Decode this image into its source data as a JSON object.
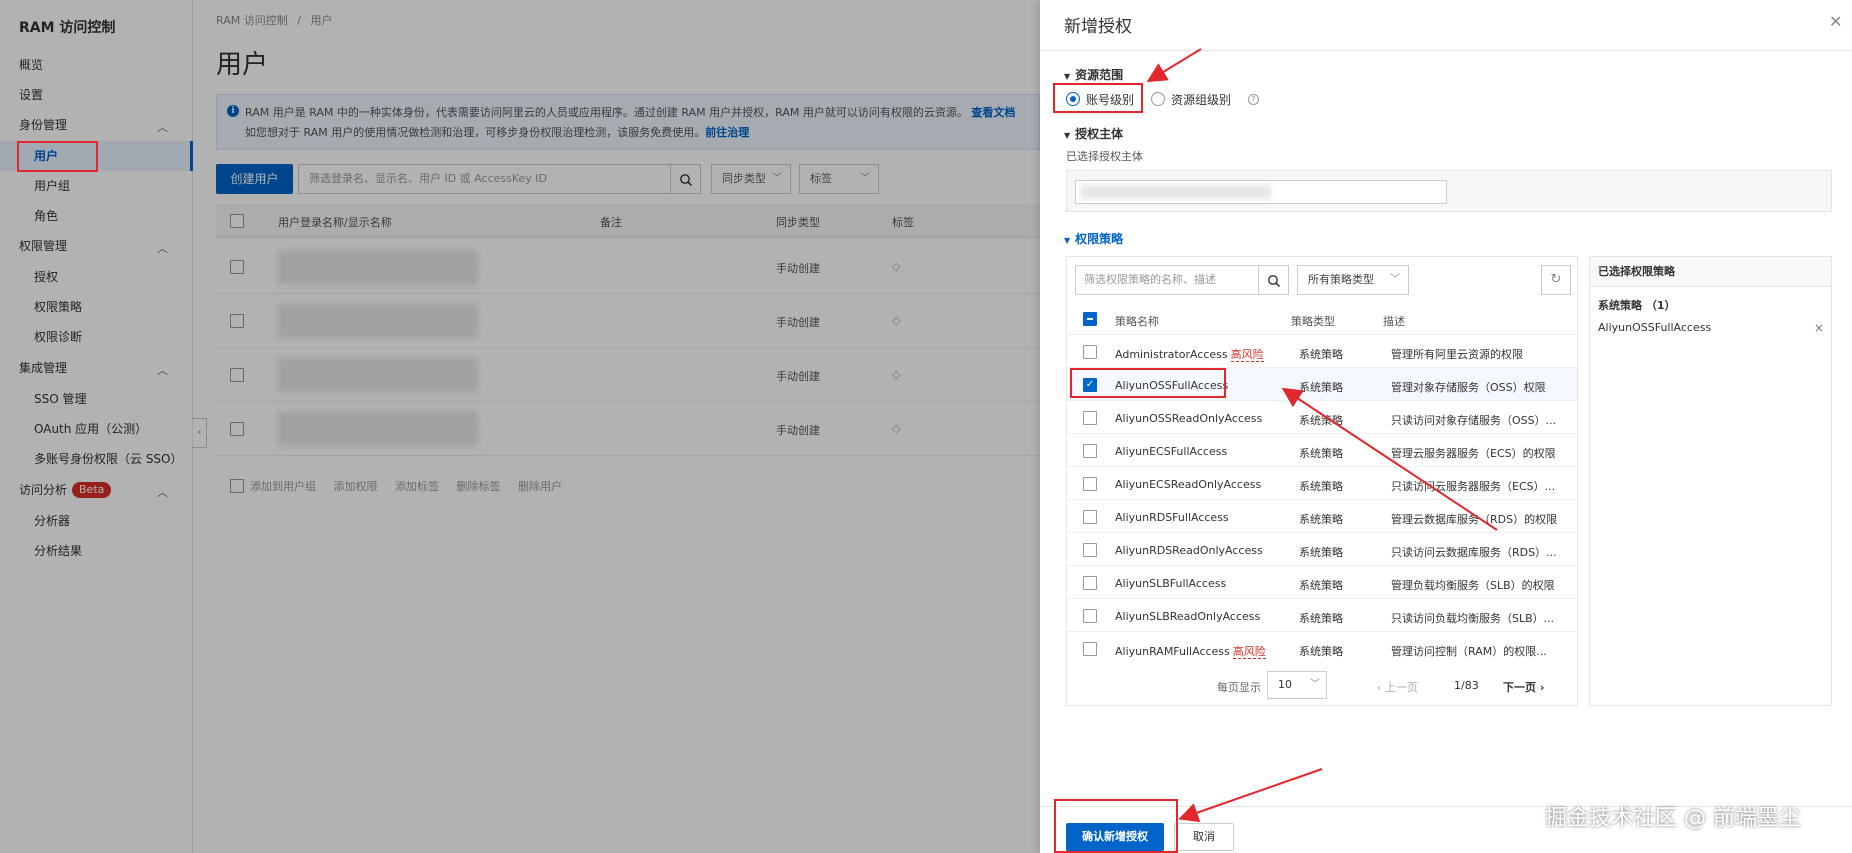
{
  "sidebar": {
    "title": "RAM 访问控制",
    "items": [
      {
        "label": "概览"
      },
      {
        "label": "设置"
      },
      {
        "label": "身份管理"
      },
      {
        "label": "用户"
      },
      {
        "label": "用户组"
      },
      {
        "label": "角色"
      },
      {
        "label": "权限管理"
      },
      {
        "label": "授权"
      },
      {
        "label": "权限策略"
      },
      {
        "label": "权限诊断"
      },
      {
        "label": "集成管理"
      },
      {
        "label": "SSO 管理"
      },
      {
        "label": "OAuth 应用（公测）"
      },
      {
        "label": "多账号身份权限（云 SSO）"
      },
      {
        "label": "访问分析"
      },
      {
        "label": "分析器"
      },
      {
        "label": "分析结果"
      }
    ],
    "beta_badge": "Beta"
  },
  "main": {
    "breadcrumb": [
      "RAM 访问控制",
      "/",
      "用户"
    ],
    "title": "用户",
    "info_line1": "RAM 用户是 RAM 中的一种实体身份，代表需要访问阿里云的人员或应用程序。通过创建 RAM 用户并授权，RAM 用户就可以访问有权限的云资源。",
    "info_link1": "查看文档",
    "info_line2": "如您想对于 RAM 用户的使用情况做检测和治理，可移步身份权限治理检测，该服务免费使用。",
    "info_link2": "前往治理",
    "create_button": "创建用户",
    "search_placeholder": "筛选登录名、显示名、用户 ID 或 AccessKey ID",
    "sync_filter": "同步类型",
    "tag_filter": "标签",
    "columns": [
      "用户登录名称/显示名称",
      "备注",
      "同步类型",
      "标签"
    ],
    "rows": [
      {
        "sync": "手动创建"
      },
      {
        "sync": "手动创建"
      },
      {
        "sync": "手动创建"
      },
      {
        "sync": "手动创建"
      }
    ],
    "bulk_actions": [
      "添加到用户组",
      "添加权限",
      "添加标签",
      "删除标签",
      "删除用户"
    ]
  },
  "drawer": {
    "title": "新增授权",
    "scope_title": "资源范围",
    "scope_account": "账号级别",
    "scope_group": "资源组级别",
    "principal_title": "授权主体",
    "principal_selected_label": "已选择授权主体",
    "policy_title": "权限策略",
    "policy_search_placeholder": "筛选权限策略的名称、描述",
    "policy_type_filter": "所有策略类型",
    "policy_columns": [
      "策略名称",
      "策略类型",
      "描述"
    ],
    "policies": [
      {
        "name": "AdministratorAccess",
        "risk": "高风险",
        "type": "系统策略",
        "desc": "管理所有阿里云资源的权限",
        "checked": false
      },
      {
        "name": "AliyunOSSFullAccess",
        "risk": "",
        "type": "系统策略",
        "desc": "管理对象存储服务（OSS）权限",
        "checked": true
      },
      {
        "name": "AliyunOSSReadOnlyAccess",
        "risk": "",
        "type": "系统策略",
        "desc": "只读访问对象存储服务（OSS）...",
        "checked": false
      },
      {
        "name": "AliyunECSFullAccess",
        "risk": "",
        "type": "系统策略",
        "desc": "管理云服务器服务（ECS）的权限",
        "checked": false
      },
      {
        "name": "AliyunECSReadOnlyAccess",
        "risk": "",
        "type": "系统策略",
        "desc": "只读访问云服务器服务（ECS）...",
        "checked": false
      },
      {
        "name": "AliyunRDSFullAccess",
        "risk": "",
        "type": "系统策略",
        "desc": "管理云数据库服务（RDS）的权限",
        "checked": false
      },
      {
        "name": "AliyunRDSReadOnlyAccess",
        "risk": "",
        "type": "系统策略",
        "desc": "只读访问云数据库服务（RDS）...",
        "checked": false
      },
      {
        "name": "AliyunSLBFullAccess",
        "risk": "",
        "type": "系统策略",
        "desc": "管理负载均衡服务（SLB）的权限",
        "checked": false
      },
      {
        "name": "AliyunSLBReadOnlyAccess",
        "risk": "",
        "type": "系统策略",
        "desc": "只读访问负载均衡服务（SLB）...",
        "checked": false
      },
      {
        "name": "AliyunRAMFullAccess",
        "risk": "高风险",
        "type": "系统策略",
        "desc": "管理访问控制（RAM）的权限...",
        "checked": false
      }
    ],
    "pager": {
      "per_page_label": "每页显示",
      "per_page": "10",
      "prev": "上一页",
      "page": "1/83",
      "next": "下一页"
    },
    "selected_title": "已选择权限策略",
    "selected_group": "系统策略 （1）",
    "selected_item": "AliyunOSSFullAccess",
    "confirm_button": "确认新增授权",
    "cancel_button": "取消"
  },
  "watermark": "掘金技术社区 @ 前端墨尘",
  "colors": {
    "primary": "#0064c8",
    "danger": "#d93026",
    "annotation": "#e0282e"
  }
}
